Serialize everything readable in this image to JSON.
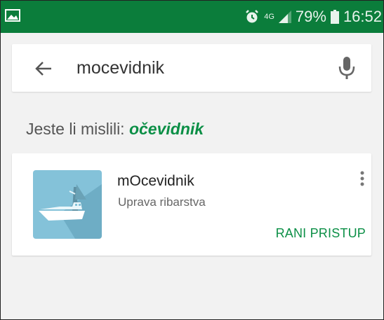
{
  "status_bar": {
    "network": "4G",
    "battery": "79%",
    "time": "16:52",
    "left_icon": "image-icon",
    "alarm_icon": "alarm-icon"
  },
  "search": {
    "query": "mocevidnik",
    "back_icon": "arrow-back-icon",
    "mic_icon": "mic-icon"
  },
  "suggestion": {
    "prefix": "Jeste li mislili:",
    "term": "očevidnik"
  },
  "results": [
    {
      "title": "mOcevidnik",
      "developer": "Uprava ribarstva",
      "badge": "RANI PRISTUP",
      "icon": "fishing-boat-icon",
      "menu_icon": "more-vert-icon"
    }
  ],
  "colors": {
    "status_bar": "#0b7d3b",
    "accent": "#0b8f46",
    "background": "#f2f2f2",
    "icon_bg": "#84c2d9"
  }
}
